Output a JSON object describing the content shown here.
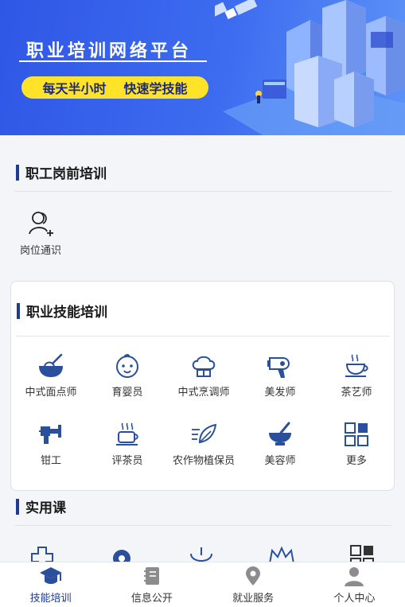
{
  "banner": {
    "title": "职业培训网络平台",
    "slogan_left": "每天半小时",
    "slogan_right": "快速学技能"
  },
  "pre_job": {
    "title": "职工岗前培训",
    "items": [
      {
        "label": "岗位通识",
        "icon": "user-add-icon"
      }
    ]
  },
  "vocational": {
    "title": "职业技能培训",
    "items": [
      {
        "label": "中式面点师",
        "icon": "dough-bowl-icon"
      },
      {
        "label": "育婴员",
        "icon": "baby-face-icon"
      },
      {
        "label": "中式烹调师",
        "icon": "chef-hat-icon"
      },
      {
        "label": "美发师",
        "icon": "hair-dryer-icon"
      },
      {
        "label": "茶艺师",
        "icon": "tea-cup-icon"
      },
      {
        "label": "钳工",
        "icon": "vise-icon"
      },
      {
        "label": "评茶员",
        "icon": "tea-tasting-icon"
      },
      {
        "label": "农作物植保员",
        "icon": "leaf-icon"
      },
      {
        "label": "美容师",
        "icon": "mortar-icon"
      },
      {
        "label": "更多",
        "icon": "grid-more-icon"
      }
    ]
  },
  "practical": {
    "title": "实用课"
  },
  "nav": {
    "items": [
      {
        "label": "技能培训",
        "icon": "graduation-cap-icon",
        "active": true
      },
      {
        "label": "信息公开",
        "icon": "notebook-icon",
        "active": false
      },
      {
        "label": "就业服务",
        "icon": "location-pin-icon",
        "active": false
      },
      {
        "label": "个人中心",
        "icon": "person-icon",
        "active": false
      }
    ]
  },
  "colors": {
    "primary": "#1f3c8f",
    "banner_blue": "#3d6cf0",
    "slogan_yellow": "#ffe328",
    "icon_blue": "#2a4f9c"
  }
}
